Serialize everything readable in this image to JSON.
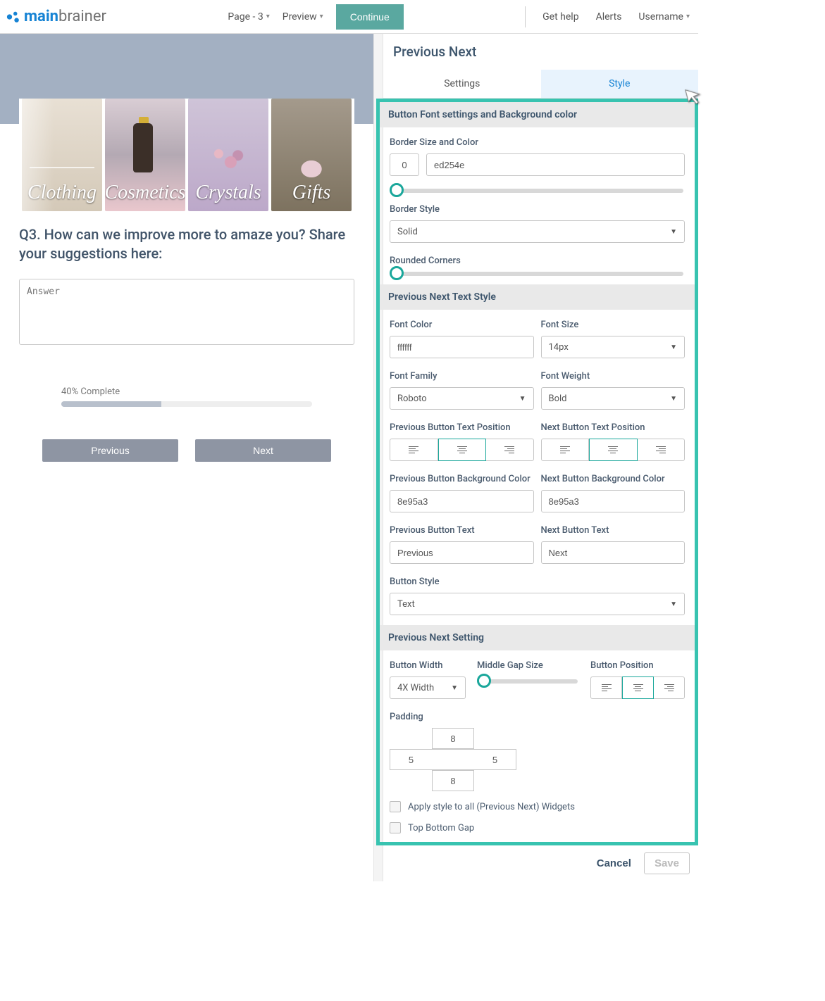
{
  "header": {
    "logo1": "main",
    "logo2": "brainer",
    "page_dropdown": "Page - 3",
    "preview": "Preview",
    "continue": "Continue",
    "get_help": "Get help",
    "alerts": "Alerts",
    "username": "Username"
  },
  "canvas": {
    "cards": [
      "Clothing",
      "Cosmetics",
      "Crystals",
      "Gifts"
    ],
    "question": "Q3. How can we improve more to amaze you? Share your suggestions here:",
    "answer_placeholder": "Answer",
    "progress_label": "40% Complete",
    "progress_pct": 40,
    "prev_btn": "Previous",
    "next_btn": "Next"
  },
  "panel": {
    "title": "Previous Next",
    "tab_settings": "Settings",
    "tab_style": "Style",
    "sec1": {
      "header": "Button Font settings and Background color",
      "border_size_color": "Border Size and Color",
      "border_size": "0",
      "border_color": "ed254e",
      "border_style_lbl": "Border Style",
      "border_style": "Solid",
      "rounded_lbl": "Rounded Corners"
    },
    "sec2": {
      "header": "Previous Next Text Style",
      "font_color_lbl": "Font Color",
      "font_color": "ffffff",
      "font_size_lbl": "Font Size",
      "font_size": "14px",
      "font_family_lbl": "Font Family",
      "font_family": "Roboto",
      "font_weight_lbl": "Font Weight",
      "font_weight": "Bold",
      "prev_pos_lbl": "Previous Button Text Position",
      "next_pos_lbl": "Next Button Text Position",
      "prev_bg_lbl": "Previous Button Background Color",
      "prev_bg": "8e95a3",
      "next_bg_lbl": "Next Button Background Color",
      "next_bg": "8e95a3",
      "prev_text_lbl": "Previous Button Text",
      "prev_text": "Previous",
      "next_text_lbl": "Next Button Text",
      "next_text": "Next",
      "btn_style_lbl": "Button Style",
      "btn_style": "Text"
    },
    "sec3": {
      "header": "Previous Next Setting",
      "width_lbl": "Button Width",
      "width": "4X Width",
      "gap_lbl": "Middle Gap Size",
      "pos_lbl": "Button Position",
      "padding_lbl": "Padding",
      "pad_top": "8",
      "pad_left": "5",
      "pad_right": "5",
      "pad_bottom": "8",
      "apply_all": "Apply style to all (Previous Next) Widgets",
      "top_bottom": "Top Bottom Gap"
    },
    "footer": {
      "cancel": "Cancel",
      "save": "Save"
    }
  }
}
